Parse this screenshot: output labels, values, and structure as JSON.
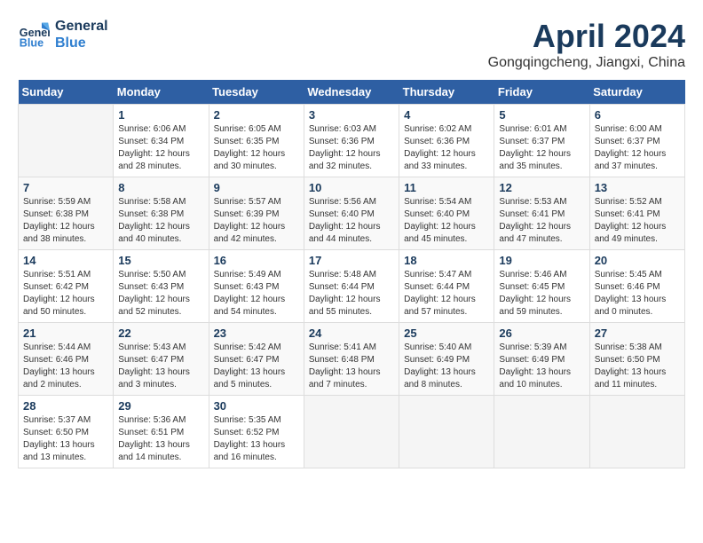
{
  "header": {
    "logo_line1": "General",
    "logo_line2": "Blue",
    "month": "April 2024",
    "location": "Gongqingcheng, Jiangxi, China"
  },
  "days_of_week": [
    "Sunday",
    "Monday",
    "Tuesday",
    "Wednesday",
    "Thursday",
    "Friday",
    "Saturday"
  ],
  "weeks": [
    [
      {
        "day": "",
        "sunrise": "",
        "sunset": "",
        "daylight": ""
      },
      {
        "day": "1",
        "sunrise": "Sunrise: 6:06 AM",
        "sunset": "Sunset: 6:34 PM",
        "daylight": "Daylight: 12 hours and 28 minutes."
      },
      {
        "day": "2",
        "sunrise": "Sunrise: 6:05 AM",
        "sunset": "Sunset: 6:35 PM",
        "daylight": "Daylight: 12 hours and 30 minutes."
      },
      {
        "day": "3",
        "sunrise": "Sunrise: 6:03 AM",
        "sunset": "Sunset: 6:36 PM",
        "daylight": "Daylight: 12 hours and 32 minutes."
      },
      {
        "day": "4",
        "sunrise": "Sunrise: 6:02 AM",
        "sunset": "Sunset: 6:36 PM",
        "daylight": "Daylight: 12 hours and 33 minutes."
      },
      {
        "day": "5",
        "sunrise": "Sunrise: 6:01 AM",
        "sunset": "Sunset: 6:37 PM",
        "daylight": "Daylight: 12 hours and 35 minutes."
      },
      {
        "day": "6",
        "sunrise": "Sunrise: 6:00 AM",
        "sunset": "Sunset: 6:37 PM",
        "daylight": "Daylight: 12 hours and 37 minutes."
      }
    ],
    [
      {
        "day": "7",
        "sunrise": "Sunrise: 5:59 AM",
        "sunset": "Sunset: 6:38 PM",
        "daylight": "Daylight: 12 hours and 38 minutes."
      },
      {
        "day": "8",
        "sunrise": "Sunrise: 5:58 AM",
        "sunset": "Sunset: 6:38 PM",
        "daylight": "Daylight: 12 hours and 40 minutes."
      },
      {
        "day": "9",
        "sunrise": "Sunrise: 5:57 AM",
        "sunset": "Sunset: 6:39 PM",
        "daylight": "Daylight: 12 hours and 42 minutes."
      },
      {
        "day": "10",
        "sunrise": "Sunrise: 5:56 AM",
        "sunset": "Sunset: 6:40 PM",
        "daylight": "Daylight: 12 hours and 44 minutes."
      },
      {
        "day": "11",
        "sunrise": "Sunrise: 5:54 AM",
        "sunset": "Sunset: 6:40 PM",
        "daylight": "Daylight: 12 hours and 45 minutes."
      },
      {
        "day": "12",
        "sunrise": "Sunrise: 5:53 AM",
        "sunset": "Sunset: 6:41 PM",
        "daylight": "Daylight: 12 hours and 47 minutes."
      },
      {
        "day": "13",
        "sunrise": "Sunrise: 5:52 AM",
        "sunset": "Sunset: 6:41 PM",
        "daylight": "Daylight: 12 hours and 49 minutes."
      }
    ],
    [
      {
        "day": "14",
        "sunrise": "Sunrise: 5:51 AM",
        "sunset": "Sunset: 6:42 PM",
        "daylight": "Daylight: 12 hours and 50 minutes."
      },
      {
        "day": "15",
        "sunrise": "Sunrise: 5:50 AM",
        "sunset": "Sunset: 6:43 PM",
        "daylight": "Daylight: 12 hours and 52 minutes."
      },
      {
        "day": "16",
        "sunrise": "Sunrise: 5:49 AM",
        "sunset": "Sunset: 6:43 PM",
        "daylight": "Daylight: 12 hours and 54 minutes."
      },
      {
        "day": "17",
        "sunrise": "Sunrise: 5:48 AM",
        "sunset": "Sunset: 6:44 PM",
        "daylight": "Daylight: 12 hours and 55 minutes."
      },
      {
        "day": "18",
        "sunrise": "Sunrise: 5:47 AM",
        "sunset": "Sunset: 6:44 PM",
        "daylight": "Daylight: 12 hours and 57 minutes."
      },
      {
        "day": "19",
        "sunrise": "Sunrise: 5:46 AM",
        "sunset": "Sunset: 6:45 PM",
        "daylight": "Daylight: 12 hours and 59 minutes."
      },
      {
        "day": "20",
        "sunrise": "Sunrise: 5:45 AM",
        "sunset": "Sunset: 6:46 PM",
        "daylight": "Daylight: 13 hours and 0 minutes."
      }
    ],
    [
      {
        "day": "21",
        "sunrise": "Sunrise: 5:44 AM",
        "sunset": "Sunset: 6:46 PM",
        "daylight": "Daylight: 13 hours and 2 minutes."
      },
      {
        "day": "22",
        "sunrise": "Sunrise: 5:43 AM",
        "sunset": "Sunset: 6:47 PM",
        "daylight": "Daylight: 13 hours and 3 minutes."
      },
      {
        "day": "23",
        "sunrise": "Sunrise: 5:42 AM",
        "sunset": "Sunset: 6:47 PM",
        "daylight": "Daylight: 13 hours and 5 minutes."
      },
      {
        "day": "24",
        "sunrise": "Sunrise: 5:41 AM",
        "sunset": "Sunset: 6:48 PM",
        "daylight": "Daylight: 13 hours and 7 minutes."
      },
      {
        "day": "25",
        "sunrise": "Sunrise: 5:40 AM",
        "sunset": "Sunset: 6:49 PM",
        "daylight": "Daylight: 13 hours and 8 minutes."
      },
      {
        "day": "26",
        "sunrise": "Sunrise: 5:39 AM",
        "sunset": "Sunset: 6:49 PM",
        "daylight": "Daylight: 13 hours and 10 minutes."
      },
      {
        "day": "27",
        "sunrise": "Sunrise: 5:38 AM",
        "sunset": "Sunset: 6:50 PM",
        "daylight": "Daylight: 13 hours and 11 minutes."
      }
    ],
    [
      {
        "day": "28",
        "sunrise": "Sunrise: 5:37 AM",
        "sunset": "Sunset: 6:50 PM",
        "daylight": "Daylight: 13 hours and 13 minutes."
      },
      {
        "day": "29",
        "sunrise": "Sunrise: 5:36 AM",
        "sunset": "Sunset: 6:51 PM",
        "daylight": "Daylight: 13 hours and 14 minutes."
      },
      {
        "day": "30",
        "sunrise": "Sunrise: 5:35 AM",
        "sunset": "Sunset: 6:52 PM",
        "daylight": "Daylight: 13 hours and 16 minutes."
      },
      {
        "day": "",
        "sunrise": "",
        "sunset": "",
        "daylight": ""
      },
      {
        "day": "",
        "sunrise": "",
        "sunset": "",
        "daylight": ""
      },
      {
        "day": "",
        "sunrise": "",
        "sunset": "",
        "daylight": ""
      },
      {
        "day": "",
        "sunrise": "",
        "sunset": "",
        "daylight": ""
      }
    ]
  ]
}
